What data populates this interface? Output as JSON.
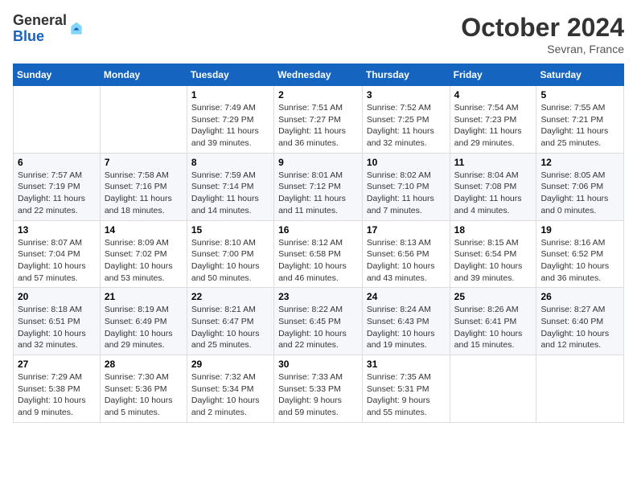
{
  "logo": {
    "general": "General",
    "blue": "Blue"
  },
  "title": "October 2024",
  "location": "Sevran, France",
  "days_header": [
    "Sunday",
    "Monday",
    "Tuesday",
    "Wednesday",
    "Thursday",
    "Friday",
    "Saturday"
  ],
  "weeks": [
    [
      {
        "day": "",
        "info": ""
      },
      {
        "day": "",
        "info": ""
      },
      {
        "day": "1",
        "info": "Sunrise: 7:49 AM\nSunset: 7:29 PM\nDaylight: 11 hours and 39 minutes."
      },
      {
        "day": "2",
        "info": "Sunrise: 7:51 AM\nSunset: 7:27 PM\nDaylight: 11 hours and 36 minutes."
      },
      {
        "day": "3",
        "info": "Sunrise: 7:52 AM\nSunset: 7:25 PM\nDaylight: 11 hours and 32 minutes."
      },
      {
        "day": "4",
        "info": "Sunrise: 7:54 AM\nSunset: 7:23 PM\nDaylight: 11 hours and 29 minutes."
      },
      {
        "day": "5",
        "info": "Sunrise: 7:55 AM\nSunset: 7:21 PM\nDaylight: 11 hours and 25 minutes."
      }
    ],
    [
      {
        "day": "6",
        "info": "Sunrise: 7:57 AM\nSunset: 7:19 PM\nDaylight: 11 hours and 22 minutes."
      },
      {
        "day": "7",
        "info": "Sunrise: 7:58 AM\nSunset: 7:16 PM\nDaylight: 11 hours and 18 minutes."
      },
      {
        "day": "8",
        "info": "Sunrise: 7:59 AM\nSunset: 7:14 PM\nDaylight: 11 hours and 14 minutes."
      },
      {
        "day": "9",
        "info": "Sunrise: 8:01 AM\nSunset: 7:12 PM\nDaylight: 11 hours and 11 minutes."
      },
      {
        "day": "10",
        "info": "Sunrise: 8:02 AM\nSunset: 7:10 PM\nDaylight: 11 hours and 7 minutes."
      },
      {
        "day": "11",
        "info": "Sunrise: 8:04 AM\nSunset: 7:08 PM\nDaylight: 11 hours and 4 minutes."
      },
      {
        "day": "12",
        "info": "Sunrise: 8:05 AM\nSunset: 7:06 PM\nDaylight: 11 hours and 0 minutes."
      }
    ],
    [
      {
        "day": "13",
        "info": "Sunrise: 8:07 AM\nSunset: 7:04 PM\nDaylight: 10 hours and 57 minutes."
      },
      {
        "day": "14",
        "info": "Sunrise: 8:09 AM\nSunset: 7:02 PM\nDaylight: 10 hours and 53 minutes."
      },
      {
        "day": "15",
        "info": "Sunrise: 8:10 AM\nSunset: 7:00 PM\nDaylight: 10 hours and 50 minutes."
      },
      {
        "day": "16",
        "info": "Sunrise: 8:12 AM\nSunset: 6:58 PM\nDaylight: 10 hours and 46 minutes."
      },
      {
        "day": "17",
        "info": "Sunrise: 8:13 AM\nSunset: 6:56 PM\nDaylight: 10 hours and 43 minutes."
      },
      {
        "day": "18",
        "info": "Sunrise: 8:15 AM\nSunset: 6:54 PM\nDaylight: 10 hours and 39 minutes."
      },
      {
        "day": "19",
        "info": "Sunrise: 8:16 AM\nSunset: 6:52 PM\nDaylight: 10 hours and 36 minutes."
      }
    ],
    [
      {
        "day": "20",
        "info": "Sunrise: 8:18 AM\nSunset: 6:51 PM\nDaylight: 10 hours and 32 minutes."
      },
      {
        "day": "21",
        "info": "Sunrise: 8:19 AM\nSunset: 6:49 PM\nDaylight: 10 hours and 29 minutes."
      },
      {
        "day": "22",
        "info": "Sunrise: 8:21 AM\nSunset: 6:47 PM\nDaylight: 10 hours and 25 minutes."
      },
      {
        "day": "23",
        "info": "Sunrise: 8:22 AM\nSunset: 6:45 PM\nDaylight: 10 hours and 22 minutes."
      },
      {
        "day": "24",
        "info": "Sunrise: 8:24 AM\nSunset: 6:43 PM\nDaylight: 10 hours and 19 minutes."
      },
      {
        "day": "25",
        "info": "Sunrise: 8:26 AM\nSunset: 6:41 PM\nDaylight: 10 hours and 15 minutes."
      },
      {
        "day": "26",
        "info": "Sunrise: 8:27 AM\nSunset: 6:40 PM\nDaylight: 10 hours and 12 minutes."
      }
    ],
    [
      {
        "day": "27",
        "info": "Sunrise: 7:29 AM\nSunset: 5:38 PM\nDaylight: 10 hours and 9 minutes."
      },
      {
        "day": "28",
        "info": "Sunrise: 7:30 AM\nSunset: 5:36 PM\nDaylight: 10 hours and 5 minutes."
      },
      {
        "day": "29",
        "info": "Sunrise: 7:32 AM\nSunset: 5:34 PM\nDaylight: 10 hours and 2 minutes."
      },
      {
        "day": "30",
        "info": "Sunrise: 7:33 AM\nSunset: 5:33 PM\nDaylight: 9 hours and 59 minutes."
      },
      {
        "day": "31",
        "info": "Sunrise: 7:35 AM\nSunset: 5:31 PM\nDaylight: 9 hours and 55 minutes."
      },
      {
        "day": "",
        "info": ""
      },
      {
        "day": "",
        "info": ""
      }
    ]
  ]
}
